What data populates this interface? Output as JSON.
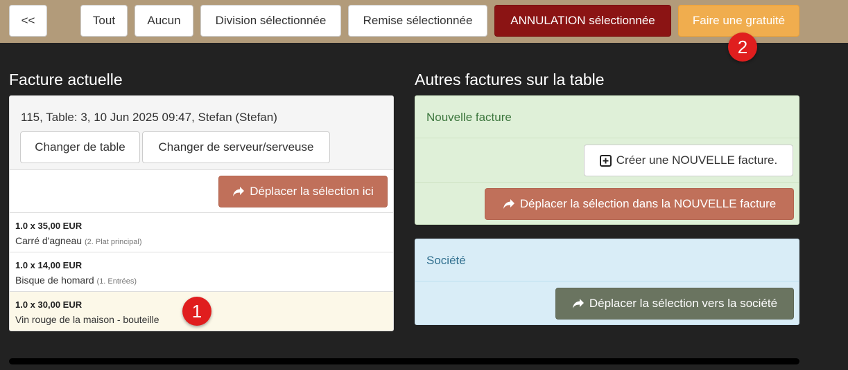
{
  "toolbar": {
    "back_label": "<<",
    "all_label": "Tout",
    "none_label": "Aucun",
    "split_label": "Division sélectionnée",
    "discount_label": "Remise sélectionnée",
    "cancel_label": "ANNULATION sélectionnée",
    "free_label": "Faire une gratuité"
  },
  "annotations": {
    "badge1": "1",
    "badge2": "2"
  },
  "current_invoice": {
    "title": "Facture actuelle",
    "header_info": "115, Table: 3, 10 Jun 2025 09:47, Stefan (Stefan)",
    "change_table_label": "Changer de table",
    "change_server_label": "Changer de serveur/serveuse",
    "move_here_label": "Déplacer la sélection ici",
    "items": [
      {
        "qty": "1.0 x 35,00 EUR",
        "name": "Carré d'agneau",
        "category": "(2. Plat principal)"
      },
      {
        "qty": "1.0 x 14,00 EUR",
        "name": "Bisque de homard",
        "category": "(1. Entrées)"
      },
      {
        "qty": "1.0 x 30,00 EUR",
        "name": "Vin rouge de la maison - bouteille",
        "category": ""
      }
    ]
  },
  "other_invoices": {
    "title": "Autres factures sur la table",
    "new_invoice": {
      "heading": "Nouvelle facture",
      "create_label": "Créer une NOUVELLE facture.",
      "move_label": "Déplacer la sélection dans la NOUVELLE facture"
    },
    "company": {
      "heading": "Société",
      "move_label": "Déplacer la sélection vers la société"
    }
  },
  "colors": {
    "toolbar_bg": "#b29b7a",
    "page_bg": "#222222",
    "danger": "#8b1414",
    "warning": "#f0ad4e",
    "brick": "#c0705a",
    "olive": "#6a7460",
    "green_panel": "#dff0d8",
    "blue_panel": "#d9edf7",
    "selected_row": "#fcf8e8"
  },
  "icons": {
    "share": "share-arrow-icon",
    "plus_square": "plus-square-icon"
  }
}
